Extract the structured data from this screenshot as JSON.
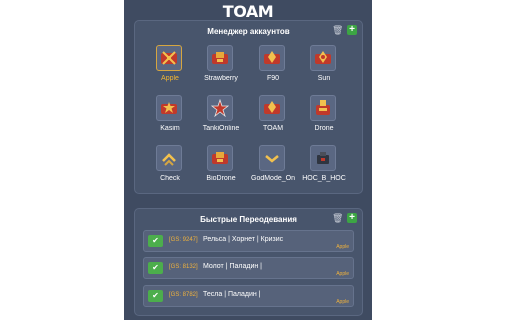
{
  "app": {
    "logo": "TOAM"
  },
  "accounts": {
    "title": "Менеджер аккаунтов",
    "delete_icon": "trash-icon",
    "add_icon": "plus-icon",
    "items": [
      {
        "label": "Apple",
        "rank": "crossed-swords",
        "active": true
      },
      {
        "label": "Strawberry",
        "rank": "red-badge"
      },
      {
        "label": "F90",
        "rank": "red-badge-gold"
      },
      {
        "label": "Sun",
        "rank": "red-badge-gold"
      },
      {
        "label": "Kasim",
        "rank": "red-badge-star"
      },
      {
        "label": "TankiOnline",
        "rank": "red-star"
      },
      {
        "label": "TOAM",
        "rank": "red-badge-gold"
      },
      {
        "label": "Drone",
        "rank": "red-badge-drone"
      },
      {
        "label": "Check",
        "rank": "gold-chevrons"
      },
      {
        "label": "BioDrone",
        "rank": "red-badge"
      },
      {
        "label": "GodMode_On",
        "rank": "gold-chevron"
      },
      {
        "label": "HOC_B_HOC",
        "rank": "grey-tank"
      }
    ]
  },
  "dress": {
    "title": "Быстрые Переодевания",
    "delete_icon": "trash-icon",
    "add_icon": "plus-icon",
    "items": [
      {
        "gs": "[GS: 9247]",
        "text": "Рельса | Хорнет | Кризис",
        "owner": "Apple"
      },
      {
        "gs": "[GS: 8132]",
        "text": "Молот | Паладин |",
        "owner": "Apple"
      },
      {
        "gs": "[GS: 8782]",
        "text": "Тесла | Паладин |",
        "owner": "Apple"
      }
    ]
  }
}
